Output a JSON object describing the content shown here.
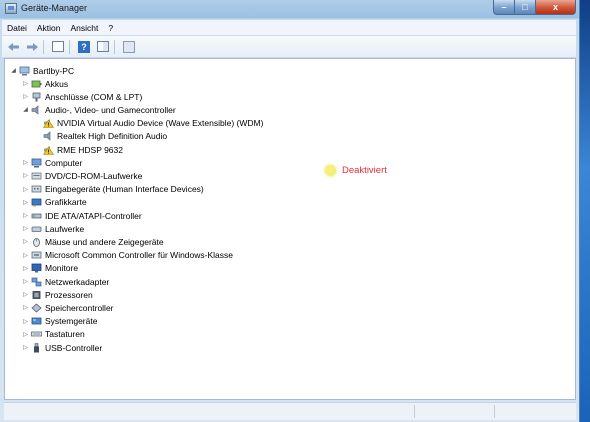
{
  "window": {
    "title": "Geräte-Manager",
    "caption_min": "–",
    "caption_max": "□",
    "caption_close": "x"
  },
  "menu": [
    "Datei",
    "Aktion",
    "Ansicht",
    "?"
  ],
  "toolbar": {
    "back_icon": "arrow-left-icon",
    "forward_icon": "arrow-right-icon",
    "help_label": "?"
  },
  "tree": {
    "root": "Bartlby-PC",
    "items": [
      {
        "label": "Akkus",
        "icon": "battery-icon",
        "state": "collapsed",
        "level": 1
      },
      {
        "label": "Anschlüsse (COM & LPT)",
        "icon": "port-icon",
        "state": "collapsed",
        "level": 1
      },
      {
        "label": "Audio-, Video- und Gamecontroller",
        "icon": "speaker-icon",
        "state": "expanded",
        "level": 1
      },
      {
        "label": "NVIDIA Virtual Audio Device (Wave Extensible) (WDM)",
        "icon": "warning-device-icon",
        "state": "leaf",
        "level": 2
      },
      {
        "label": "Realtek High Definition Audio",
        "icon": "speaker-icon",
        "state": "leaf",
        "level": 2
      },
      {
        "label": "RME HDSP 9632",
        "icon": "warning-device-icon",
        "state": "leaf",
        "level": 2
      },
      {
        "label": "Computer",
        "icon": "computer-icon",
        "state": "collapsed",
        "level": 1
      },
      {
        "label": "DVD/CD-ROM-Laufwerke",
        "icon": "disc-icon",
        "state": "collapsed",
        "level": 1
      },
      {
        "label": "Eingabegeräte (Human Interface Devices)",
        "icon": "hid-icon",
        "state": "collapsed",
        "level": 1
      },
      {
        "label": "Grafikkarte",
        "icon": "display-adapter-icon",
        "state": "collapsed",
        "level": 1
      },
      {
        "label": "IDE ATA/ATAPI-Controller",
        "icon": "ide-icon",
        "state": "collapsed",
        "level": 1
      },
      {
        "label": "Laufwerke",
        "icon": "drive-icon",
        "state": "collapsed",
        "level": 1
      },
      {
        "label": "Mäuse und andere Zeigegeräte",
        "icon": "mouse-icon",
        "state": "collapsed",
        "level": 1
      },
      {
        "label": "Microsoft Common Controller für Windows-Klasse",
        "icon": "controller-icon",
        "state": "collapsed",
        "level": 1
      },
      {
        "label": "Monitore",
        "icon": "monitor-icon",
        "state": "collapsed",
        "level": 1
      },
      {
        "label": "Netzwerkadapter",
        "icon": "network-icon",
        "state": "collapsed",
        "level": 1
      },
      {
        "label": "Prozessoren",
        "icon": "cpu-icon",
        "state": "collapsed",
        "level": 1
      },
      {
        "label": "Speichercontroller",
        "icon": "storage-icon",
        "state": "collapsed",
        "level": 1
      },
      {
        "label": "Systemgeräte",
        "icon": "system-icon",
        "state": "collapsed",
        "level": 1
      },
      {
        "label": "Tastaturen",
        "icon": "keyboard-icon",
        "state": "collapsed",
        "level": 1
      },
      {
        "label": "USB-Controller",
        "icon": "usb-icon",
        "state": "collapsed",
        "level": 1
      }
    ]
  },
  "annotation": {
    "text": "Deaktiviert"
  },
  "colors": {
    "annotation_text": "#e0303a",
    "annotation_dot": "#f5f07a",
    "warning": "#f2c81c"
  }
}
